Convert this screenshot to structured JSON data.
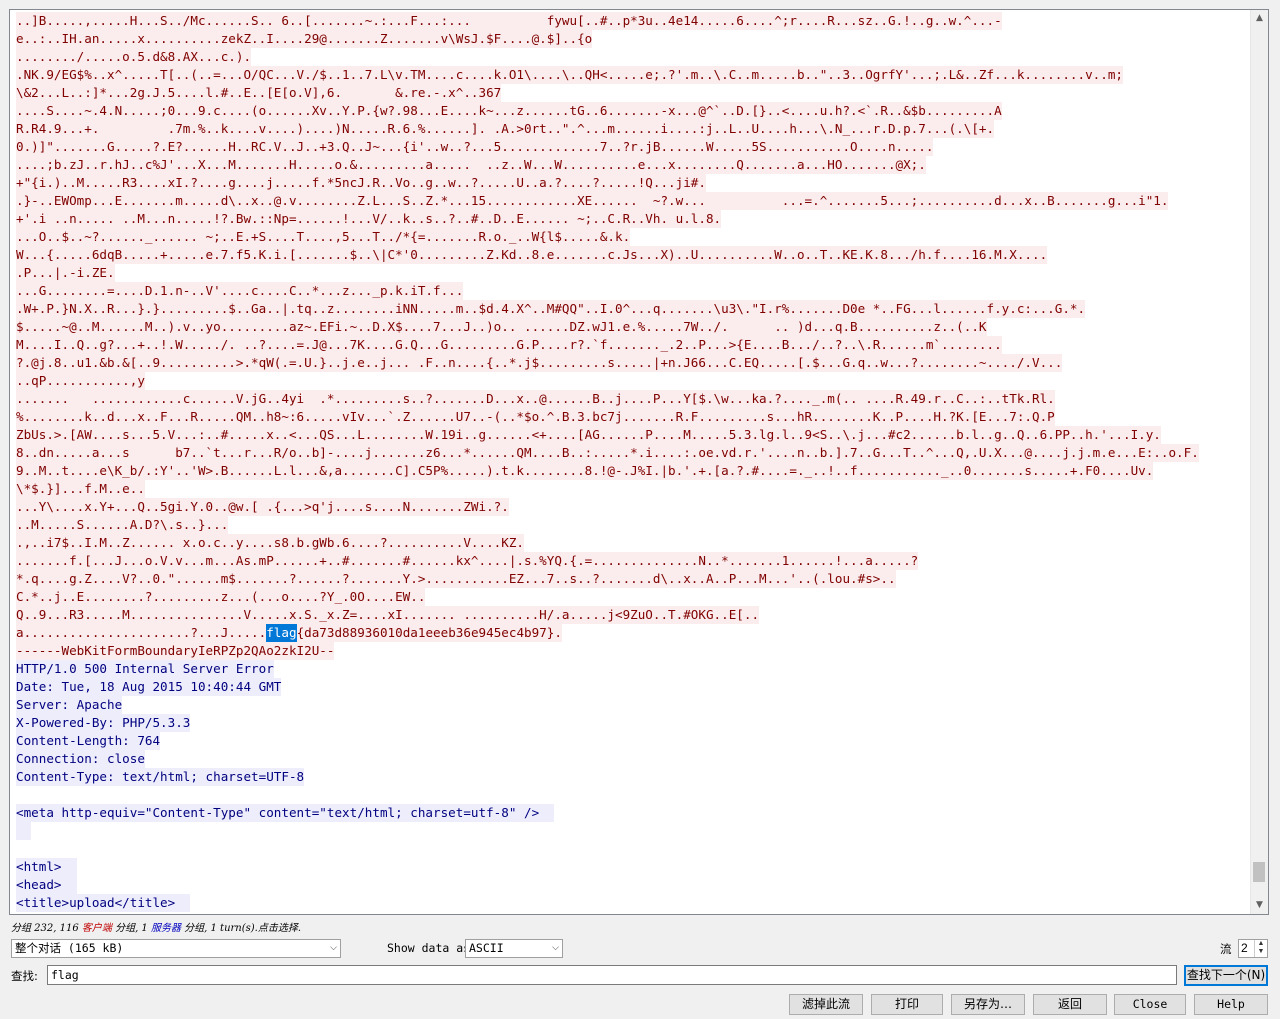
{
  "colors": {
    "client_bg": "#fbeded",
    "client_fg": "#800000",
    "server_bg": "#ededfb",
    "server_fg": "#000080",
    "highlight_bg": "#0078d7"
  },
  "stream_lines": [
    {
      "dir": "client",
      "text": "..]B.....,.....H...S../Mc......S.. 6..[.......~.:...F...:...          fywu[..#..p*3u..4e14.....6....^;r....R...sz..G.!..g..w.^...-"
    },
    {
      "dir": "client",
      "text": "e..:..IH.an.....x..........zekZ..I....29@.......Z.......v\\WsJ.$F....@.$]..{o"
    },
    {
      "dir": "client",
      "text": "......../.....o.5.d&8.AX...c.)."
    },
    {
      "dir": "client",
      "text": ".NK.9/EG$%..x^.....T[..(..=...O/QC...V./$..1..7.L\\v.TM....c....k.O1\\....\\..QH<.....e;.?'.m..\\.C..m.....b..\"..3..OgrfY'...;.L&..Zf...k........v..m;"
    },
    {
      "dir": "client",
      "text": "\\&2...L..:]*...2g.J.5....l.#..E..[E[o.V],6.       &.re.-.x^..367"
    },
    {
      "dir": "client",
      "text": "....S....~.4.N.....;0...9.c....(o......Xv..Y.P.{w?.98...E....k~...z......tG..6.......-x...@^`..D.[}..<....u.h?.<`.R..&$b.........A"
    },
    {
      "dir": "client",
      "text": "R.R4.9...+.         .7m.%..k....v....)....)N.....R.6.%......]. .A.>0rt..\".^...m......i....:j..L..U....h...\\.N_...r.D.p.7...(.\\[+."
    },
    {
      "dir": "client",
      "text": "0.)]\".......G.....?.E?......H..RC.V..J..+3.Q..J~...{i'..w..?...5.............7..?r.jB......W.....5S...........O....n....."
    },
    {
      "dir": "client",
      "text": "....;b.zJ..r.hJ..c%J'...X...M.......H.....o.&.........a.....  ..z..W...W..........e...x........Q.......a...HO.......@X;."
    },
    {
      "dir": "client",
      "text": "+\"{i.)..M.....R3....xI.?....g....j.....f.*5ncJ.R..Vo..g..w..?.....U..a.?....?.....!Q...ji#."
    },
    {
      "dir": "client",
      "text": ".}-..EWOmp...E.......m.....d\\..x..@.v........Z.L...S..Z.*...15............XE......  ~?.w...          ...=.^.......5...;..........d...x..B.......g...i\"1."
    },
    {
      "dir": "client",
      "text": "+'.i ..n..... ..M...n.....!?.Bw.::Np=......!...V/..k..s..?..#..D..E...... ~;..C.R..Vh. u.l.8."
    },
    {
      "dir": "client",
      "text": "...O..$..~?......_...... ~;..E.+S....T....,5...T../*{=.......R.o._..W{l$.....&.k."
    },
    {
      "dir": "client",
      "text": "W...{.....6dqB.....+.....e.7.f5.K.i.[.......$..\\|C*'0.........Z.Kd..8.e.......c.Js...X)..U..........W..o..T..KE.K.8.../h.f....16.M.X...."
    },
    {
      "dir": "client",
      "text": ".P...|.-i.ZE."
    },
    {
      "dir": "client",
      "text": "...G........=....D.1.n-..V'....c....C..*...z..._p.k.iT.f..."
    },
    {
      "dir": "client",
      "text": ".W+.P.}N.X..R...}.}.........$..Ga..|.tq..z........iNN.....m..$d.4.X^..M#QQ\"..I.0^...q.......\\u3\\.\"I.r%.......D0e *..FG...l......f.y.c:...G.*."
    },
    {
      "dir": "client",
      "text": "$.....~@..M......M..).v..yo.........az~.EFi.~..D.X$....7...J..)o.. ......DZ.wJ1.e.%.....7W../.      .. )d...q.B..........z..(..K"
    },
    {
      "dir": "client",
      "text": "M....I..Q..g?...+..!.W...../. ..?....=.J@...7K....G.Q...G.........G.P....r?.`f......._.2..P...>{E....B.../..?..\\.R......m`........"
    },
    {
      "dir": "client",
      "text": "?.@j.8..u1.&b.&[..9..........>.*qW(.=.U.}..j.e..j... .F..n....{..*.j$.........s.....|+n.J66...C.EQ.....[.$...G.q..w...?........~..../.V..."
    },
    {
      "dir": "client",
      "text": "..qP...........,y"
    },
    {
      "dir": "client",
      "text": ".......   ............c......V.jG..4yi  .*.........s..?.......D...x..@......B..j....P...Y[$.\\w...ka.?...._.m(.. ....R.49.r..C..:..tTk.Rl."
    },
    {
      "dir": "client",
      "text": "%........k..d...x..F...R.....QM..h8~:6.....vIv...`.Z......U7..-(..*$o.^.B.3.bc7j.......R.F.........s...hR........K..P....H.?K.[E...7:.Q.P"
    },
    {
      "dir": "client",
      "text": "ZbUs.>.[AW....s...5.V...:..#.....x..<...QS...L........W.19i..g......<+....[AG......P....M.....5.3.lg.l..9<S..\\.j...#c2......b.l..g..Q..6.PP..h.'...I.y."
    },
    {
      "dir": "client",
      "text": "8..dn.....a...s      b7..`t...r...R/o..b]-....j.......z6...*......QM....B..:.....*.i....:.oe.vd.r.'....n..b.].7..G...T..^...Q,.U.X...@....j.j.m.e...E:..o.F."
    },
    {
      "dir": "client",
      "text": "9..M..t....e\\K_b/.:Y'..'W>.B......L.l...&,a.......C].C5P%.....).t.k........8.!@-.J%I.|b.'.+.[a.?.#....=._..!..f..........._..0.......s.....+.F0....Uv."
    },
    {
      "dir": "client",
      "text": "\\*$.}]...f.M..e.."
    },
    {
      "dir": "client",
      "text": "...Y\\....x.Y+...Q..5gi.Y.0..@w.[ .{...>q'j....s....N.......ZWi.?."
    },
    {
      "dir": "client",
      "text": "..M.....S......A.D?\\.s..}..."
    },
    {
      "dir": "client",
      "text": ".,..i7$..I.M..Z...... x.o.c..y....s8.b.gWb.6....?..........V....KZ."
    },
    {
      "dir": "client",
      "text": ".......f.[...J...o.V.v...m...As.mP......+..#.......#......kx^....|.s.%YQ.{.=..............N..*.......1......!...a.....?"
    },
    {
      "dir": "client",
      "text": "*.q....g.Z....V?..0.\"......m$.......?......?.......Y.>...........EZ...7..s..?.......d\\..x..A..P...M...'..(.lou.#s>.."
    },
    {
      "dir": "client",
      "text": "C.*..j..E........?.........z...(...o....?Y_.0O....EW.."
    },
    {
      "dir": "client",
      "text": "Q..9...R3.....M...............V.....x.S._x.Z=....xI....... ..........H/.a.....j<9ZuO..T.#OKG..E[.."
    },
    {
      "dir": "client",
      "text": "a......................?...J.....",
      "hl": "flag",
      "after": "{da73d88936010da1eeeb36e945ec4b97}."
    },
    {
      "dir": "client",
      "text": "------WebKitFormBoundaryIeRPZp2QAo2zkI2U--"
    },
    {
      "dir": "server",
      "text": "HTTP/1.0 500 Internal Server Error"
    },
    {
      "dir": "server",
      "text": "Date: Tue, 18 Aug 2015 10:40:44 GMT"
    },
    {
      "dir": "server",
      "text": "Server: Apache"
    },
    {
      "dir": "server",
      "text": "X-Powered-By: PHP/5.3.3"
    },
    {
      "dir": "server",
      "text": "Content-Length: 764"
    },
    {
      "dir": "server",
      "text": "Connection: close"
    },
    {
      "dir": "server",
      "text": "Content-Type: text/html; charset=UTF-8"
    },
    {
      "dir": "server",
      "text": ""
    },
    {
      "dir": "server",
      "text": "<meta http-equiv=\"Content-Type\" content=\"text/html; charset=utf-8\" />  "
    },
    {
      "dir": "server",
      "text": "  "
    },
    {
      "dir": "server",
      "text": ""
    },
    {
      "dir": "server",
      "text": "<html>  "
    },
    {
      "dir": "server",
      "text": "<head>  "
    },
    {
      "dir": "server",
      "text": "<title>upload</title>  "
    }
  ],
  "summary": {
    "p1": "分组 232, 116 ",
    "client": "客户端",
    "p2": " 分组, 1 ",
    "server": "服务器",
    "p3": " 分组, 1 turn(s).点击选择."
  },
  "conversation_select": {
    "value": "整个对话 (165 kB)"
  },
  "show_data": {
    "label": "Show data as",
    "value": "ASCII"
  },
  "stream": {
    "label": "流",
    "value": "2"
  },
  "find": {
    "label": "查找:",
    "value": "flag",
    "next_button": "查找下一个(N)"
  },
  "buttons": {
    "filter": "滤掉此流",
    "print": "打印",
    "save_as": "另存为…",
    "back": "返回",
    "close": "Close",
    "help": "Help"
  },
  "icons": {
    "scroll_up": "▲",
    "scroll_down": "▼",
    "dropdown": "⌵",
    "spin_up": "▲",
    "spin_down": "▼"
  }
}
